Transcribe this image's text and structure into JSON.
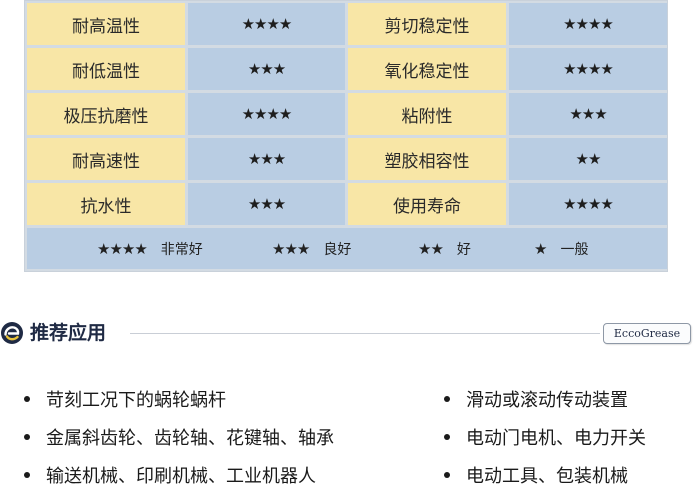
{
  "table": {
    "rows": [
      {
        "left_name": "耐高温性",
        "left_rating": "★★★★",
        "right_name": "剪切稳定性",
        "right_rating": "★★★★"
      },
      {
        "left_name": "耐低温性",
        "left_rating": "★★★",
        "right_name": "氧化稳定性",
        "right_rating": "★★★★"
      },
      {
        "left_name": "极压抗磨性",
        "left_rating": "★★★★",
        "right_name": "粘附性",
        "right_rating": "★★★"
      },
      {
        "left_name": "耐高速性",
        "left_rating": "★★★",
        "right_name": "塑胶相容性",
        "right_rating": "★★"
      },
      {
        "left_name": "抗水性",
        "left_rating": "★★★",
        "right_name": "使用寿命",
        "right_rating": "★★★★"
      }
    ],
    "legend": [
      {
        "stars": "★★★★",
        "label": "非常好"
      },
      {
        "stars": "★★★",
        "label": "良好"
      },
      {
        "stars": "★★",
        "label": "好"
      },
      {
        "stars": "★",
        "label": "一般"
      }
    ]
  },
  "section": {
    "title": "推荐应用",
    "brand": "EccoGrease",
    "icon": "eccogrease-logo-icon"
  },
  "applications": {
    "left": [
      "苛刻工况下的蜗轮蜗杆",
      "金属斜齿轮、齿轮轴、花键轴、轴承",
      "输送机械、印刷机械、工业机器人"
    ],
    "right": [
      "滑动或滚动传动装置",
      "电动门电机、电力开关",
      "电动工具、包装机械"
    ]
  },
  "colors": {
    "name_cell": "#f8e6a6",
    "rating_cell": "#b9cde3",
    "title": "#1f2a44"
  }
}
